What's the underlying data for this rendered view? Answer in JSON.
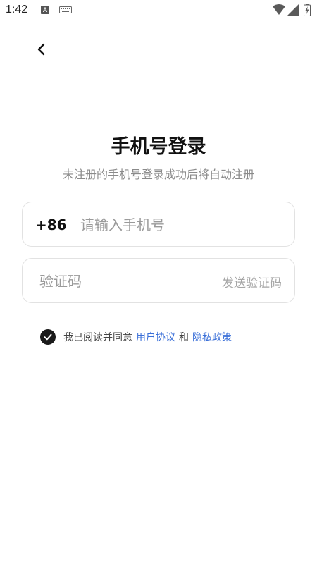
{
  "status_bar": {
    "time": "1:42",
    "a_badge": "A",
    "icons": [
      "a-icon",
      "keyboard-icon",
      "wifi-icon",
      "signal-icon",
      "battery-icon"
    ]
  },
  "nav": {
    "back_icon": "chevron-left-icon"
  },
  "header": {
    "title": "手机号登录",
    "subtitle": "未注册的手机号登录成功后将自动注册"
  },
  "form": {
    "country_code": "+86",
    "phone_placeholder": "请输入手机号",
    "phone_value": "",
    "code_placeholder": "验证码",
    "code_value": "",
    "send_code_label": "发送验证码"
  },
  "agreement": {
    "checked": true,
    "prefix": "我已阅读并同意",
    "user_agreement": "用户协议",
    "conjunction": "和",
    "privacy_policy": "隐私政策"
  },
  "colors": {
    "link": "#3a6fd8",
    "checkbox": "#1a1a1a",
    "placeholder": "#9a9a9a",
    "border": "#e2e2e2"
  }
}
